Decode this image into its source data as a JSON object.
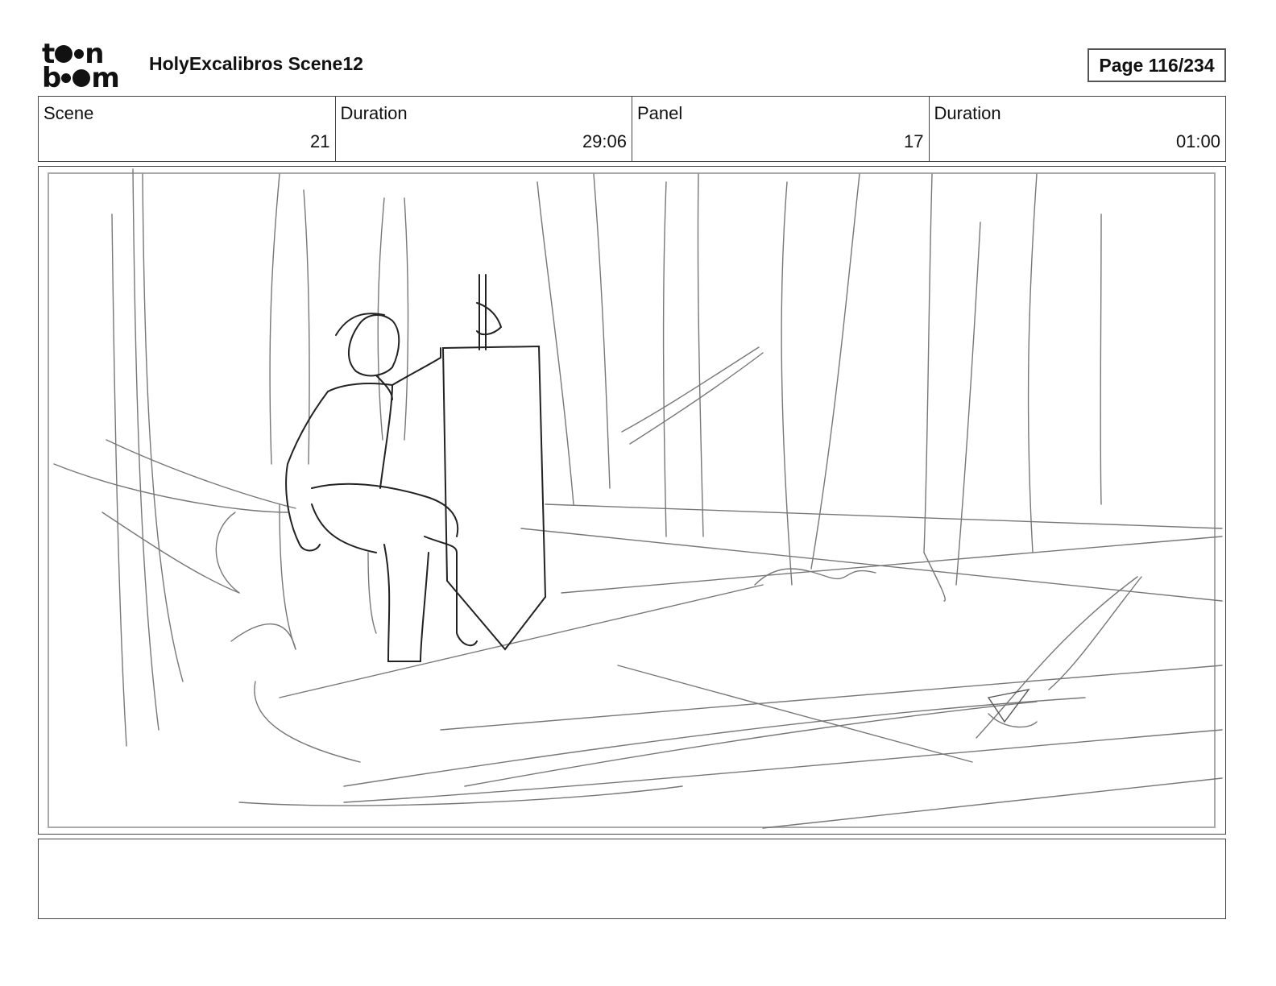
{
  "header": {
    "logo_top": "t●●n",
    "logo_bottom": "b●●m",
    "title": "HolyExcalibros Scene12",
    "page_label": "Page 116/234"
  },
  "info": [
    {
      "label": "Scene",
      "value": "21"
    },
    {
      "label": "Duration",
      "value": "29:06"
    },
    {
      "label": "Panel",
      "value": "17"
    },
    {
      "label": "Duration",
      "value": "01:00"
    }
  ],
  "panel": {
    "description": "Pencil sketch: a young man sits on a log in a forest, holding a sword above a tall shield planted in the ground; an axe is stuck in the ground at right."
  },
  "notes": {
    "text": ""
  }
}
